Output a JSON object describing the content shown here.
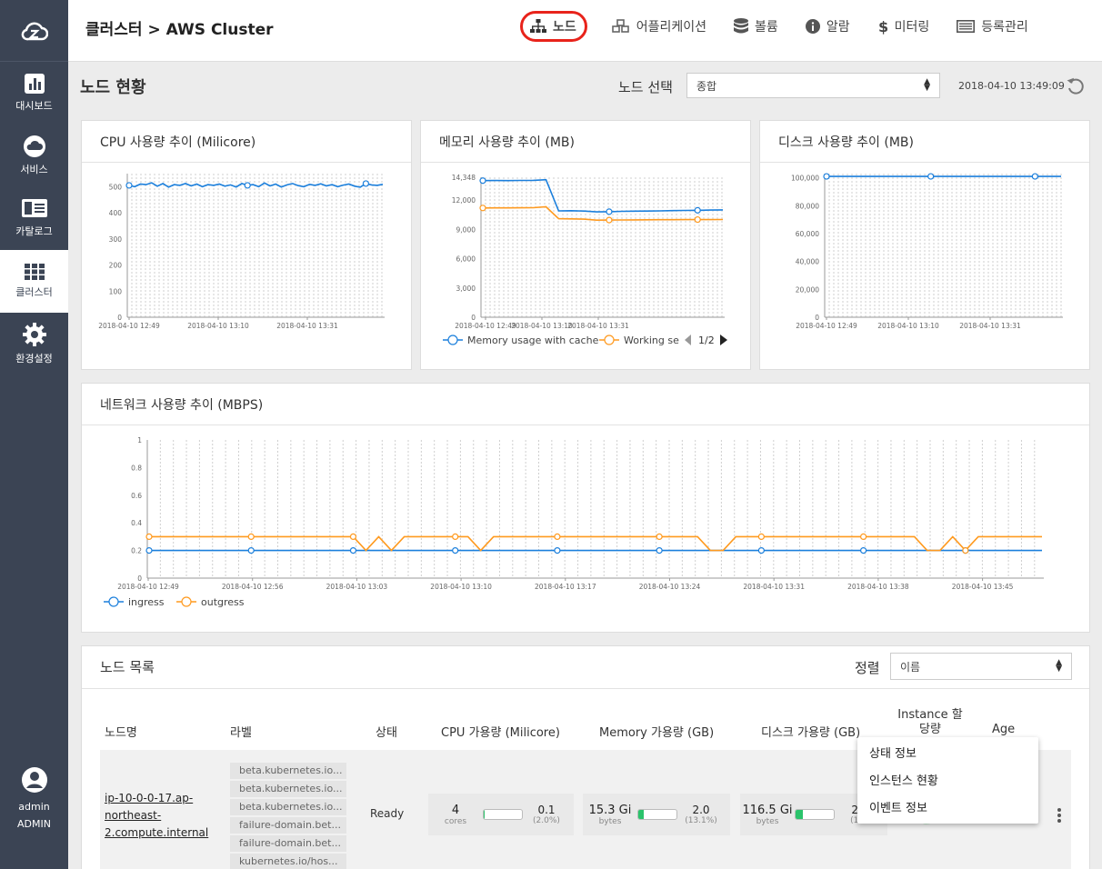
{
  "sidebar": {
    "items": [
      {
        "label": "대시보드",
        "icon": "chart-icon"
      },
      {
        "label": "서비스",
        "icon": "cloud-icon"
      },
      {
        "label": "카탈로그",
        "icon": "catalog-icon"
      },
      {
        "label": "클러스터",
        "icon": "grid-icon",
        "active": true
      },
      {
        "label": "환경설정",
        "icon": "gear-icon"
      }
    ],
    "user": {
      "name": "admin",
      "role": "ADMIN"
    }
  },
  "header": {
    "title": "클러스터 > AWS Cluster",
    "nav": [
      {
        "label": "노드",
        "icon": "node-tree-icon",
        "active": true
      },
      {
        "label": "어플리케이션",
        "icon": "cubes-icon"
      },
      {
        "label": "볼륨",
        "icon": "database-icon"
      },
      {
        "label": "알람",
        "icon": "info-icon"
      },
      {
        "label": "미터링",
        "icon": "dollar-icon"
      },
      {
        "label": "등록관리",
        "icon": "list-icon"
      }
    ]
  },
  "toolbar": {
    "title": "노드 현황",
    "node_select_label": "노드 선택",
    "node_select_value": "종합",
    "timestamp": "2018-04-10 13:49:09"
  },
  "charts": {
    "cpu_title": "CPU 사용량 추이 (Milicore)",
    "memory_title": "메모리 사용량 추이 (MB)",
    "disk_title": "디스크 사용량 추이 (MB)",
    "network_title": "네트워크 사용량 추이 (MBPS)",
    "memory_pager": "1/2"
  },
  "chart_data": [
    {
      "type": "line",
      "title": "CPU 사용량 추이 (Milicore)",
      "yticks": [
        "0",
        "100",
        "200",
        "300",
        "400",
        "500"
      ],
      "ylim": [
        0,
        550
      ],
      "xticks": [
        "2018-04-10 12:49",
        "2018-04-10 13:10",
        "2018-04-10 13:31"
      ],
      "series": [
        {
          "color": "#1b7fdc",
          "values": [
            505,
            500,
            510,
            508,
            515,
            502,
            512,
            498,
            508,
            505,
            512,
            503,
            510,
            500,
            508,
            505,
            510,
            502,
            507,
            499,
            512,
            505,
            508,
            500,
            514,
            503,
            510,
            499,
            507,
            512,
            504,
            500,
            509,
            505,
            511,
            503,
            508,
            500,
            506,
            510,
            502,
            498,
            512,
            507,
            505,
            509
          ]
        }
      ]
    },
    {
      "type": "line",
      "title": "메모리 사용량 추이 (MB)",
      "yticks": [
        "0",
        "3,000",
        "6,000",
        "9,000",
        "12,000",
        "14,348"
      ],
      "ylim": [
        0,
        14348
      ],
      "xticks": [
        "2018-04-10 12:49",
        "2018-04-10 13:10",
        "2018-04-10 13:31"
      ],
      "series": [
        {
          "name": "Memory usage with cache",
          "color": "#1b7fdc",
          "values": [
            14000,
            14010,
            14005,
            14020,
            14030,
            14100,
            10900,
            10920,
            10880,
            10800,
            10820,
            10850,
            10870,
            10880,
            10900,
            10930,
            10950,
            10960,
            10980,
            11000
          ]
        },
        {
          "name": "Working se",
          "color": "#ff9a1f",
          "values": [
            11200,
            11210,
            11205,
            11220,
            11230,
            11320,
            10100,
            10080,
            10050,
            9950,
            9960,
            9970,
            9980,
            9990,
            10000,
            10000,
            10005,
            10010,
            10010,
            10020
          ]
        }
      ]
    },
    {
      "type": "line",
      "title": "디스크 사용량 추이 (MB)",
      "yticks": [
        "0",
        "20,000",
        "40,000",
        "60,000",
        "80,000",
        "100,000"
      ],
      "ylim": [
        0,
        103000
      ],
      "xticks": [
        "2018-04-10 12:49",
        "2018-04-10 13:10",
        "2018-04-10 13:31"
      ],
      "series": [
        {
          "color": "#1b7fdc",
          "values": [
            101000,
            101000,
            101000,
            101000,
            101000,
            101000,
            101000,
            101000,
            101000,
            101000
          ]
        }
      ]
    },
    {
      "type": "line",
      "title": "네트워크 사용량 추이 (MBPS)",
      "yticks": [
        "0",
        "0.2",
        "0.4",
        "0.6",
        "0.8",
        "1"
      ],
      "ylim": [
        0,
        1
      ],
      "xticks": [
        "2018-04-10 12:49",
        "2018-04-10 12:56",
        "2018-04-10 13:03",
        "2018-04-10 13:10",
        "2018-04-10 13:17",
        "2018-04-10 13:24",
        "2018-04-10 13:31",
        "2018-04-10 13:38",
        "2018-04-10 13:45"
      ],
      "series": [
        {
          "name": "ingress",
          "color": "#1b7fdc",
          "values": [
            0.2,
            0.2,
            0.2,
            0.2,
            0.2,
            0.2,
            0.2,
            0.2,
            0.2,
            0.2,
            0.2,
            0.2,
            0.2,
            0.2,
            0.2,
            0.2,
            0.2,
            0.2,
            0.2,
            0.2,
            0.2,
            0.2,
            0.2,
            0.2,
            0.2,
            0.2,
            0.2,
            0.2,
            0.2,
            0.2,
            0.2,
            0.2,
            0.2,
            0.2,
            0.2,
            0.2,
            0.2,
            0.2,
            0.2,
            0.2,
            0.2,
            0.2,
            0.2,
            0.2,
            0.2,
            0.2,
            0.2,
            0.2,
            0.2,
            0.2,
            0.2,
            0.2,
            0.2,
            0.2,
            0.2,
            0.2,
            0.2,
            0.2,
            0.2,
            0.2,
            0.2,
            0.2,
            0.2,
            0.2,
            0.2,
            0.2,
            0.2,
            0.2,
            0.2,
            0.2,
            0.2
          ]
        },
        {
          "name": "outgress",
          "color": "#ff9a1f",
          "values": [
            0.3,
            0.3,
            0.3,
            0.3,
            0.3,
            0.3,
            0.3,
            0.3,
            0.3,
            0.3,
            0.3,
            0.3,
            0.3,
            0.3,
            0.3,
            0.3,
            0.3,
            0.2,
            0.3,
            0.2,
            0.3,
            0.3,
            0.3,
            0.3,
            0.3,
            0.3,
            0.2,
            0.3,
            0.3,
            0.3,
            0.3,
            0.3,
            0.3,
            0.3,
            0.3,
            0.3,
            0.3,
            0.3,
            0.3,
            0.3,
            0.3,
            0.3,
            0.3,
            0.3,
            0.2,
            0.2,
            0.3,
            0.3,
            0.3,
            0.3,
            0.3,
            0.3,
            0.3,
            0.3,
            0.3,
            0.3,
            0.3,
            0.3,
            0.3,
            0.3,
            0.3,
            0.2,
            0.2,
            0.3,
            0.2,
            0.3,
            0.3,
            0.3,
            0.3,
            0.3,
            0.3
          ]
        }
      ]
    }
  ],
  "node_list": {
    "title": "노드 목록",
    "sort_label": "정렬",
    "sort_value": "이름",
    "columns": [
      "노드명",
      "라벨",
      "상태",
      "CPU 가용량 (Milicore)",
      "Memory 가용량 (GB)",
      "디스크 가용량 (GB)",
      "Instance 할당량",
      "Age"
    ],
    "row": {
      "name": "ip-10-0-0-17.ap-northeast-2.compute.internal",
      "labels": [
        "beta.kubernetes.io...",
        "beta.kubernetes.io...",
        "beta.kubernetes.io...",
        "failure-domain.bet...",
        "failure-domain.bet...",
        "kubernetes.io/hos..."
      ],
      "status": "Ready",
      "cpu": {
        "total": "4",
        "unit": "cores",
        "available": "0.1",
        "pct": "(2.0%)",
        "fill": 0.02
      },
      "memory": {
        "total": "15.3 Gi",
        "unit": "bytes",
        "available": "2.0",
        "pct": "(13.1%)",
        "fill": 0.131
      },
      "disk": {
        "total": "116.5 Gi",
        "unit": "bytes",
        "available": "22",
        "pct": "(18.",
        "fill": 0.18
      }
    }
  },
  "context_menu": [
    "상태 정보",
    "인스턴스 현황",
    "이벤트 정보"
  ]
}
